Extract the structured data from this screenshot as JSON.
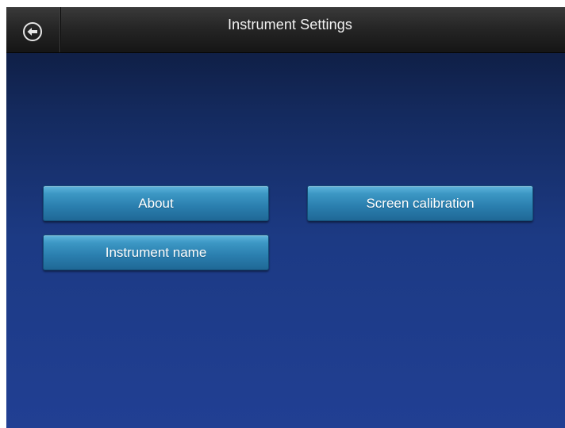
{
  "header": {
    "title": "Instrument Settings",
    "back_icon": "back-arrow-circle-icon"
  },
  "buttons": {
    "about": "About",
    "screen_calibration": "Screen calibration",
    "instrument_name": "Instrument name"
  },
  "colors": {
    "titlebar": "#262626",
    "background_top": "#0c1734",
    "background_bottom": "#213f93",
    "button": "#2a7eae",
    "button_text": "#ffffff"
  }
}
